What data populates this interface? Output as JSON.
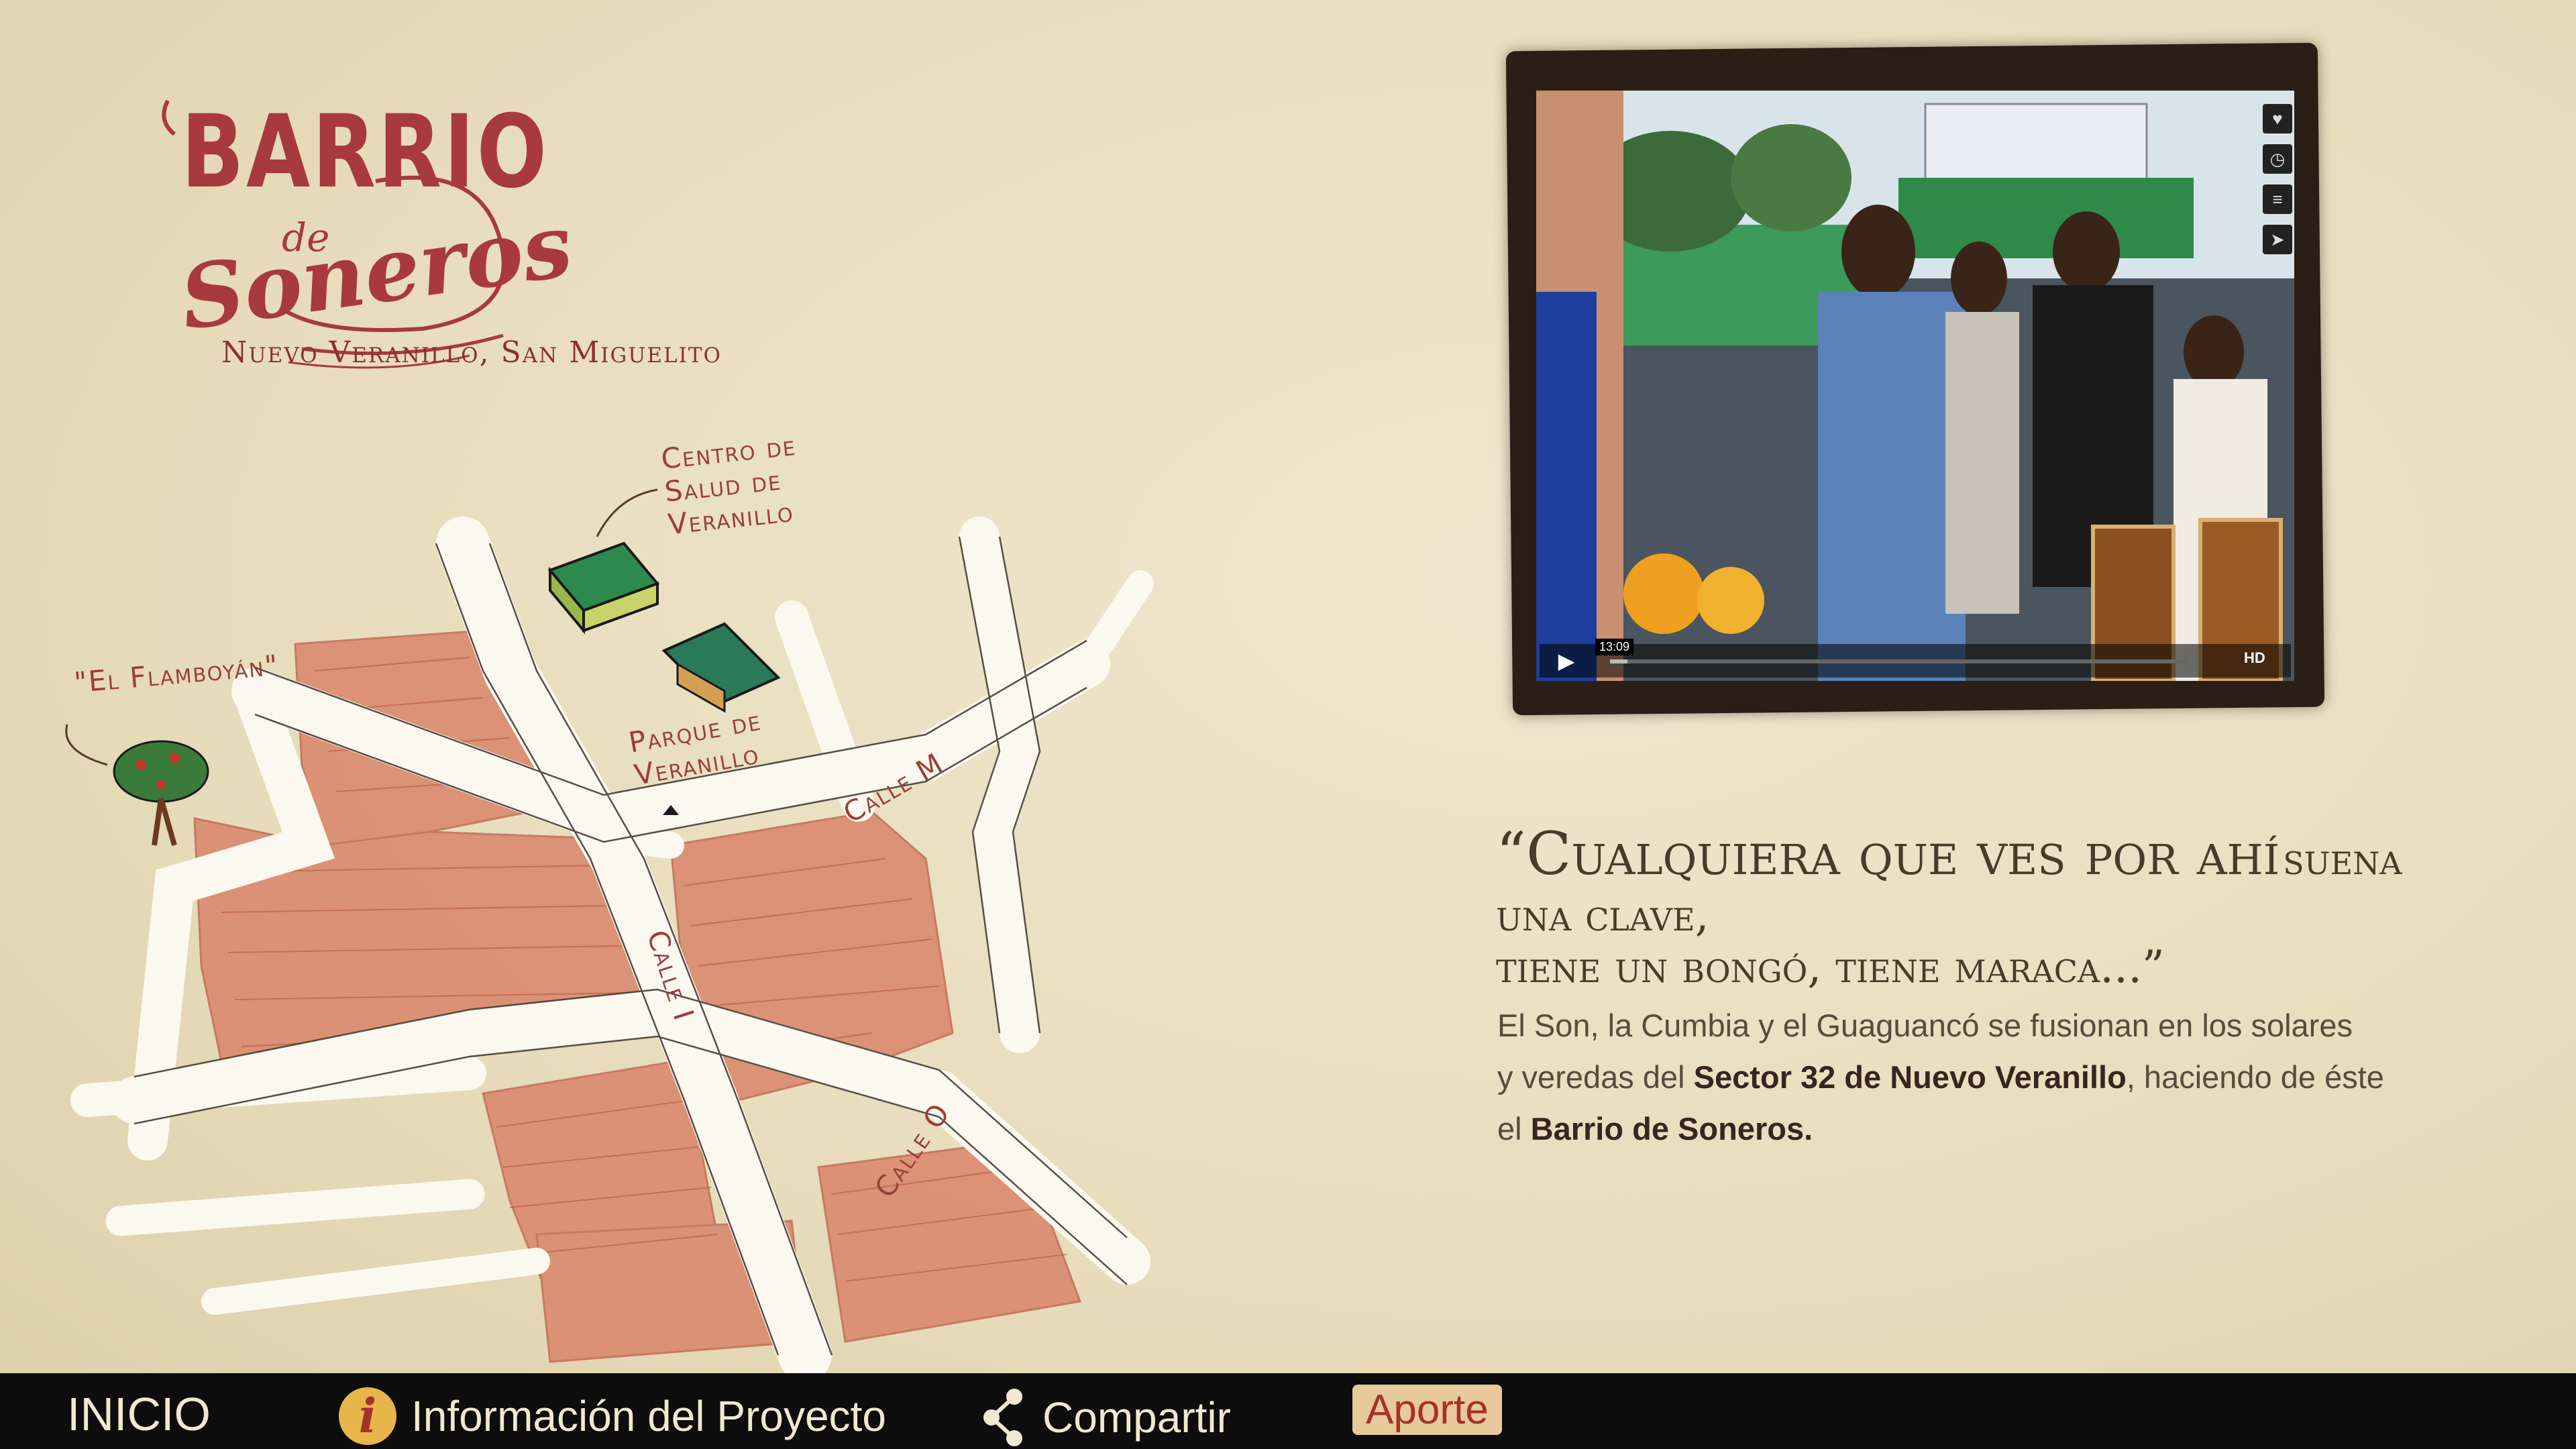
{
  "logo": {
    "line1": "BARRIO",
    "line2": "de",
    "line3": "Soneros",
    "subtitle": "Nuevo Veranillo, San Miguelito"
  },
  "map": {
    "labels": {
      "centro_salud": "Centro de Salud de Veranillo",
      "flamboyan": "\"El Flamboyán\"",
      "parque": "Parque de Veranillo",
      "calle_m": "Calle M",
      "calle_i": "Calle I",
      "calle_o": "Calle O"
    }
  },
  "video": {
    "time": "13:09",
    "hd": "HD",
    "progress": 0.03,
    "side_icons": [
      "heart-icon",
      "clock-icon",
      "layers-icon",
      "send-icon"
    ]
  },
  "quote": {
    "part1": "“Cualquiera que ves por ahí",
    "part2": "suena una clave,",
    "part3": "tiene un bongó, tiene maraca...”"
  },
  "description": {
    "text1": "El Son, la Cumbia y el Guaguancó se fusionan en los solares",
    "text2": "y veredas del ",
    "bold1": "Sector 32 de Nuevo Veranillo",
    "text3": ", haciendo de éste",
    "text4": "el ",
    "bold2": "Barrio de Soneros."
  },
  "nav": {
    "inicio": "INICIO",
    "info_icon": "i",
    "info": "Información del Proyecto",
    "share": "Compartir",
    "aporte": "Aporte"
  },
  "colors": {
    "brand": "#a8393f",
    "background": "#efe6cd",
    "bar": "#0d0d0d",
    "block": "#d9856a"
  }
}
